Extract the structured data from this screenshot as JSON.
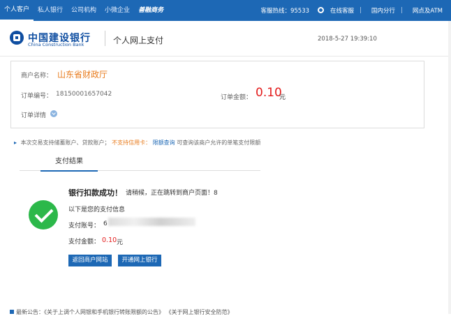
{
  "topbar": {
    "nav": [
      "个人客户",
      "私人银行",
      "公司机构",
      "小微企业"
    ],
    "promo": "善融商务",
    "hotline": "客服热线：95533",
    "online_service": "在线客服",
    "branch": "国内分行",
    "outlets": "网点及ATM"
  },
  "header": {
    "logo_cn": "中国建设银行",
    "logo_en": "China Construction Bank",
    "title": "个人网上支付",
    "datetime": "2018-5-27 19:39:10"
  },
  "merchant": {
    "name_label": "商户名称：",
    "name": "山东省财政厅",
    "order_no_label": "订单编号：",
    "order_no": "18150001657042",
    "amount_label": "订单金额：",
    "amount": "0.10",
    "currency": "元",
    "detail_label": "订单详情"
  },
  "notice": {
    "prefix": "本次交易支持储蓄账户、贷款账户；",
    "warn": "不支持信用卡：",
    "link": "限额查询",
    "suffix": "可查询该商户允许的单笔支付限额"
  },
  "tab": {
    "label": "支付结果"
  },
  "result": {
    "title": "银行扣款成功！",
    "subtitle": "请稍候，正在跳转到商户页面！8",
    "info_title": "以下是您的支付信息",
    "account_label": "支付账号：",
    "account_prefix": "6",
    "amount_label": "支付金额：",
    "amount": "0.10",
    "currency": "元"
  },
  "buttons": {
    "back": "返回商户网站",
    "open": "开通网上银行"
  },
  "bottom": {
    "text": "最新公告：《关于上调个人网银和手机银行转账限额的公告》 《关于网上银行安全防范》"
  },
  "colors": {
    "brand_blue": "#1d68b5",
    "amount_red": "#e31b1b",
    "merchant_orange": "#e87b1c",
    "success_green": "#2cb84a"
  }
}
